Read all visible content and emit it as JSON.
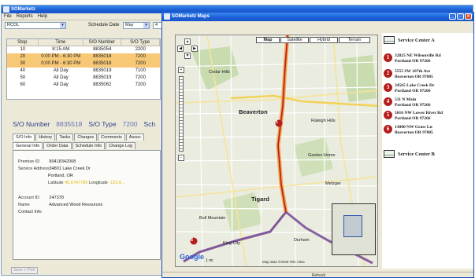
{
  "back_window": {
    "title": "SOMarketz",
    "menu": [
      "File",
      "Reports",
      "Help"
    ],
    "filter": {
      "left_select": "RCOL",
      "schedule_date_label": "Schedule Date",
      "schedule_date_value": "May",
      "right_select": "4"
    },
    "grid": {
      "columns": [
        "Stop",
        "Time",
        "S/O Number",
        "S/O Type"
      ],
      "rows": [
        [
          "10",
          "8:15 AM",
          "8835054",
          "2200"
        ],
        [
          "20",
          "0:00 PM - 6:30 PM",
          "8835018",
          "7200"
        ],
        [
          "30",
          "0:00 PM - 6:30 PM",
          "8835018",
          "7200"
        ],
        [
          "40",
          "All Day",
          "8835019",
          "7100"
        ],
        [
          "50",
          "All Day",
          "8835019",
          "7200"
        ],
        [
          "60",
          "All Day",
          "8835062",
          "7200"
        ]
      ],
      "selected_rows": [
        1,
        2
      ]
    },
    "summary": {
      "so_number_label": "S/O Number",
      "so_number": "8835518",
      "so_type_label": "S/O Type",
      "so_type": "7200",
      "sch_label": "Sch"
    },
    "tabs_top": [
      "S/O Info",
      "History",
      "Tasks",
      "Charges",
      "Comments",
      "Assoc"
    ],
    "tabs_sub": [
      "General Info",
      "Order Data",
      "Schedule Info",
      "Change Log"
    ],
    "general": {
      "premise_label": "Premise ID",
      "premise_id": "80418342008",
      "service_address_label": "Service Address",
      "address_line1": "34801 Lake Creek Dr",
      "address_line2": "Portland, OR",
      "lat_label": "Latitude",
      "lat_value": "45.0747789",
      "long_label": "Longitude",
      "long_value": "-122.6...",
      "account_label": "Account ID",
      "account_id": "247378",
      "name_label": "Name",
      "name_value": "Advanced Wood Resources",
      "contact_label": "Contact Info"
    },
    "bottom_button": "Save + Print"
  },
  "map_window": {
    "title": "SOMarketz Maps",
    "map_types": [
      "Map",
      "Satellite",
      "Hybrid",
      "Terrain"
    ],
    "active_map_type": "Map",
    "labels": {
      "city": "Beaverton",
      "l1": "Cedar Hills",
      "l2": "Raleigh Hills",
      "l3": "Garden Home",
      "l4": "Tigard",
      "l5": "Metzger",
      "l6": "King City",
      "l7": "Durham",
      "l8": "Bull Mountain"
    },
    "scale_label": "1 mi",
    "copyright": "Map data ©2009 Tele Atlas",
    "google_logo": "Google",
    "route_markers": [
      "1",
      "2",
      "3",
      "4",
      "5",
      "6"
    ],
    "sidebar": {
      "start": "Service Center A",
      "end": "Service Center B",
      "stops": [
        {
          "num": "1",
          "line1": "32825 NE Wilsonville Rd",
          "line2": "Portland OR 97266"
        },
        {
          "num": "2",
          "line1": "5555 SW 107th Ave",
          "line2": "Beaverton OR 97005"
        },
        {
          "num": "3",
          "line1": "34565 Lake Creek Dr",
          "line2": "Portland OR 97266"
        },
        {
          "num": "4",
          "line1": "511 N Main",
          "line2": "Portland OR 97266"
        },
        {
          "num": "5",
          "line1": "5016 NW Lower River Rd",
          "line2": "Portland OR 97266"
        },
        {
          "num": "6",
          "line1": "13000 NW Gross Ln",
          "line2": "Beaverton OR 97005"
        }
      ]
    },
    "refresh_label": "Refresh"
  },
  "colors": {
    "title_blue": "#1c5fd7",
    "selection": "#f7c977",
    "route_red": "#c2182b",
    "route_orange": "#f3a33a",
    "marker": "#b51d1d"
  }
}
